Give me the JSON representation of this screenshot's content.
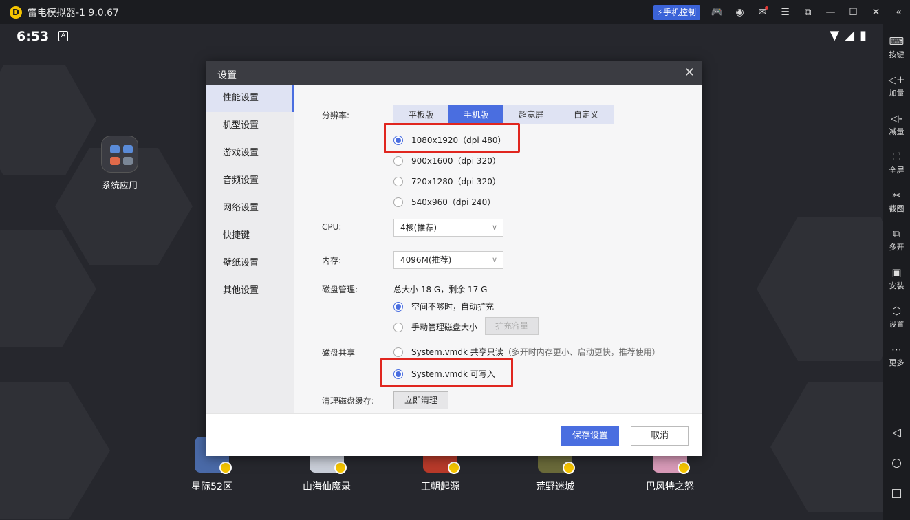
{
  "titlebar": {
    "app_title": "雷电模拟器-1 9.0.67",
    "phone_control": "手机控制",
    "logo_letter": "D"
  },
  "status": {
    "time": "6:53",
    "badge": "A"
  },
  "desktop": {
    "sys_app_label": "系统应用",
    "games": [
      {
        "label": "星际52区",
        "color": "#4a6aa8"
      },
      {
        "label": "山海仙魔录",
        "color": "#c9ced8"
      },
      {
        "label": "王朝起源",
        "color": "#b83a2a"
      },
      {
        "label": "荒野迷城",
        "color": "#6a6a3a"
      },
      {
        "label": "巴风特之怒",
        "color": "#d89ab8"
      }
    ]
  },
  "sidebar": {
    "items": [
      "按键",
      "加量",
      "减量",
      "全屏",
      "截图",
      "多开",
      "安装",
      "设置",
      "更多"
    ]
  },
  "dialog": {
    "title": "设置",
    "nav": [
      "性能设置",
      "机型设置",
      "游戏设置",
      "音频设置",
      "网络设置",
      "快捷键",
      "壁纸设置",
      "其他设置"
    ],
    "resolution": {
      "label": "分辨率:",
      "tabs": [
        "平板版",
        "手机版",
        "超宽屏",
        "自定义"
      ],
      "options": [
        "1080x1920（dpi 480）",
        "900x1600（dpi 320）",
        "720x1280（dpi 320）",
        "540x960（dpi 240）"
      ]
    },
    "cpu": {
      "label": "CPU:",
      "value": "4核(推荐)"
    },
    "memory": {
      "label": "内存:",
      "value": "4096M(推荐)"
    },
    "disk": {
      "label": "磁盘管理:",
      "info": "总大小 18 G，剩余 17 G",
      "auto_expand": "空间不够时，自动扩充",
      "manual": "手动管理磁盘大小",
      "expand_btn": "扩充容量"
    },
    "share": {
      "label": "磁盘共享",
      "readonly": "System.vmdk 共享只读",
      "readonly_hint": "（多开时内存更小、启动更快，推荐使用）",
      "writable": "System.vmdk 可写入"
    },
    "cache": {
      "label": "清理磁盘缓存:",
      "btn": "立即清理"
    },
    "footer": {
      "save": "保存设置",
      "cancel": "取消"
    }
  },
  "colors": {
    "accent": "#4a6ee0",
    "highlight": "#e0261f",
    "brand": "#f5c400"
  }
}
